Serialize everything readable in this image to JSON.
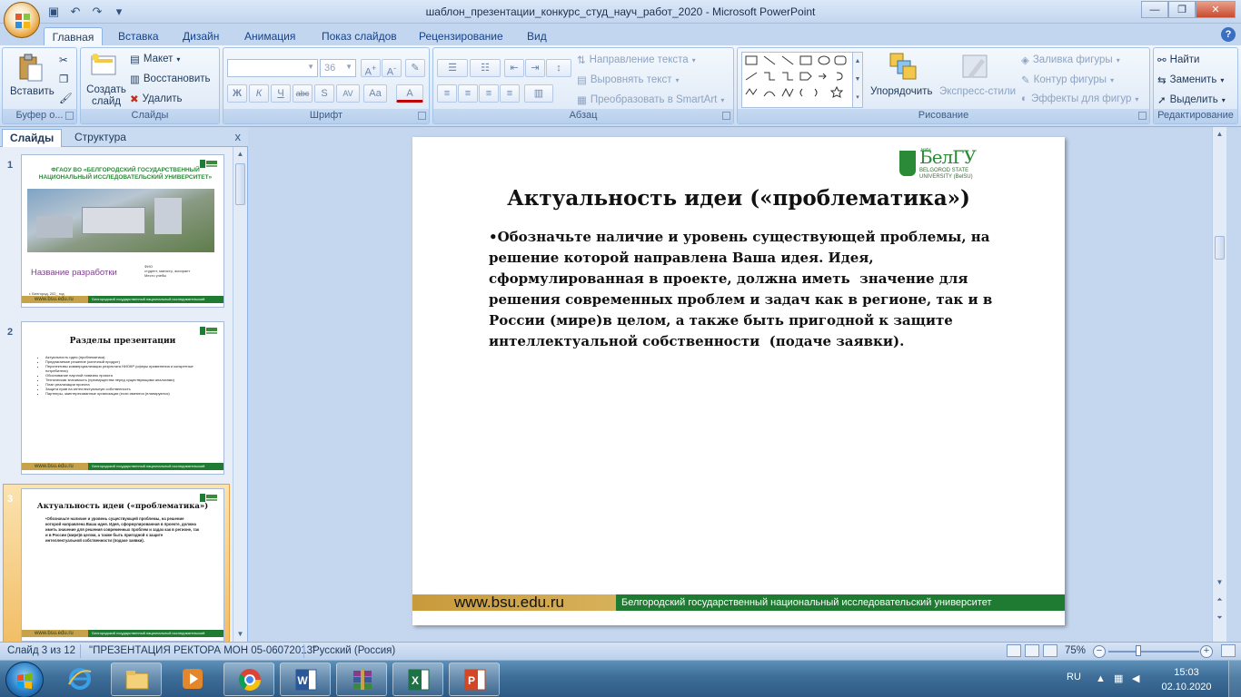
{
  "window": {
    "title": "шаблон_презентации_конкурс_студ_науч_работ_2020 - Microsoft PowerPoint",
    "controls": [
      "—",
      "❐",
      "✕"
    ]
  },
  "quick_access": [
    {
      "name": "save-icon",
      "glyph": "▣"
    },
    {
      "name": "undo-icon",
      "glyph": "↶"
    },
    {
      "name": "redo-icon",
      "glyph": "↷"
    },
    {
      "name": "customize-icon",
      "glyph": "▾"
    }
  ],
  "tabs": [
    "Главная",
    "Вставка",
    "Дизайн",
    "Анимация",
    "Показ слайдов",
    "Рецензирование",
    "Вид"
  ],
  "ribbon": {
    "clipboard": {
      "label": "Буфер о...",
      "paste": "Вставить"
    },
    "slides": {
      "label": "Слайды",
      "new_slide": "Создать слайд",
      "layout": "Макет",
      "reset": "Восстановить",
      "delete": "Удалить"
    },
    "font": {
      "label": "Шрифт",
      "font_name": "",
      "font_size": "36",
      "bold": "Ж",
      "italic": "К",
      "underline": "Ч",
      "strike": "abc",
      "shadow": "S",
      "spacing": "AV",
      "case": "Aa",
      "color": "A"
    },
    "paragraph": {
      "label": "Абзац",
      "text_direction": "Направление текста",
      "align_text": "Выровнять текст",
      "smartart": "Преобразовать в SmartArt"
    },
    "drawing": {
      "label": "Рисование",
      "arrange": "Упорядочить",
      "quick_styles": "Экспресс-стили",
      "fill": "Заливка фигуры",
      "outline": "Контур фигуры",
      "effects": "Эффекты для фигур"
    },
    "editing": {
      "label": "Редактирование",
      "find": "Найти",
      "replace": "Заменить",
      "select": "Выделить"
    }
  },
  "left_pane": {
    "tab_slides": "Слайды",
    "tab_outline": "Структура",
    "close": "x",
    "slides": [
      {
        "num": "1",
        "title": "ФГАОУ ВО «БЕЛГОРОДСКИЙ ГОСУДАРСТВЕННЫЙ НАЦИОНАЛЬНЫЙ ИССЛЕДОВАТЕЛЬСКИЙ УНИВЕРСИТЕТ»",
        "subtitle": "Название разработки",
        "meta": "ФИО\nстудент, магистр, аспирант\nМесто учебы",
        "city": "г. Белгород, 202_ год",
        "footer_url": "www.bsu.edu.ru",
        "footer_text": "Белгородский государственный национальный исследовательский университет"
      },
      {
        "num": "2",
        "title": "Разделы презентации",
        "items": [
          "Актуальность идеи (проблематика)",
          "Предлагаемое решение (конечный продукт)",
          "Перспективы коммерциализации результата НИОКР (сферы применения и конкретные потребители)",
          "Обоснование научной новизны проекта",
          "Техническая значимость (преимущества перед существующими аналогами)",
          "План реализации проекта",
          "Защита прав на интеллектуальную собственность",
          "Партнеры, заинтересованные организации (если имеются (планируются)"
        ],
        "footer_url": "www.bsu.edu.ru",
        "footer_text": "Белгородский государственный национальный исследовательский университет"
      },
      {
        "num": "3",
        "title": "Актуальность идеи («проблематика»)",
        "body": "•Обозначьте наличие и уровень существующей проблемы, на решение которой направлена Ваша идея. Идея, сформулированная в проекте, должна иметь значение для решения современных проблем и задач как в регионе, так и в России (мире)в целом, а также быть пригодной к защите интеллектуальной собственности (подаче заявки).",
        "footer_url": "www.bsu.edu.ru",
        "footer_text": "Белгородский государственный национальный исследовательский университет"
      }
    ]
  },
  "slide": {
    "title": "Актуальность идеи («проблематика»)",
    "body_lines": [
      "•Обозначьте наличие и уровень существующей проблемы, на",
      "решение которой направлена Ваша идея. Идея,",
      "сформулированная в проекте, должна иметь  значение для",
      "решения современных проблем и задач как в регионе, так и в",
      "России (мире)в целом, а также быть пригодной к защите",
      "интеллектуальной собственности  (подаче заявки)."
    ],
    "logo_name": "БелГУ",
    "logo_niu": "НИУ",
    "logo_sub": "BELGOROD STATE\nUNIVERSITY (BelSU)",
    "footer_url": "www.bsu.edu.ru",
    "footer_text": "Белгородский государственный национальный исследовательский университет"
  },
  "statusbar": {
    "slide_info": "Слайд 3 из 12",
    "theme": "\"ПРЕЗЕНТАЦИЯ РЕКТОРА МОН 05-06072013\"",
    "language": "Русский (Россия)",
    "zoom": "75%",
    "zoom_level_percent": 75
  },
  "taskbar": {
    "apps": [
      "start",
      "internet-explorer",
      "explorer",
      "media-player",
      "chrome",
      "word",
      "winrar",
      "excel",
      "powerpoint"
    ],
    "lang": "RU",
    "time": "15:03",
    "date": "02.10.2020"
  },
  "colors": {
    "brand_green": "#1f7a32",
    "brand_gold": "#c89a3c",
    "ribbon_blue": "#c3d6ef"
  }
}
